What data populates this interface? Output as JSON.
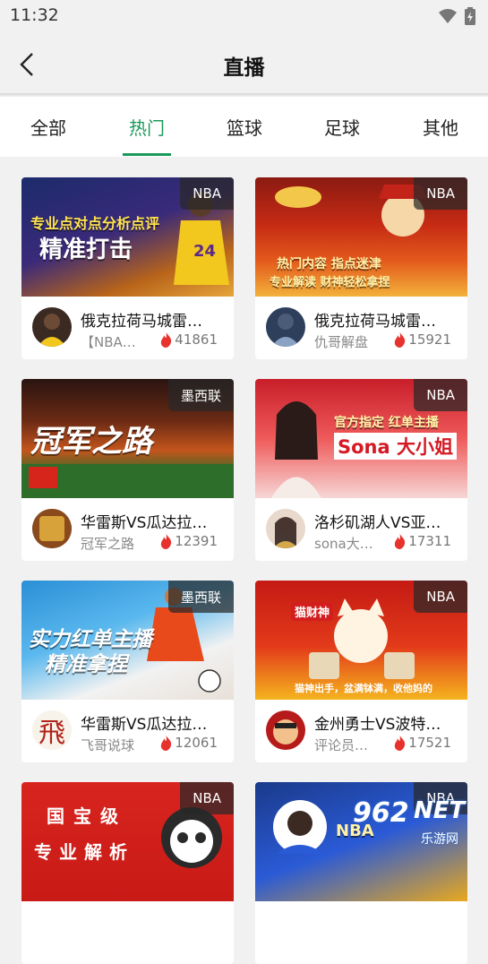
{
  "status_bar": {
    "time": "11:32"
  },
  "header": {
    "title": "直播"
  },
  "tabs": [
    {
      "label": "全部"
    },
    {
      "label": "热门",
      "active": true
    },
    {
      "label": "篮球"
    },
    {
      "label": "足球"
    },
    {
      "label": "其他"
    }
  ],
  "colors": {
    "accent": "#1a9a5a",
    "heat": "#e8322d"
  },
  "cards": [
    {
      "badge": "NBA",
      "thumb_text_1": "专业点对点分析点评",
      "thumb_text_2": "精准打击",
      "title": "俄克拉荷马城雷…",
      "anchor": "【NBA…",
      "heat": "41861",
      "avatar_icon": "player-avatar-icon"
    },
    {
      "badge": "NBA",
      "thumb_text_1": "热门内容 指点迷津",
      "thumb_text_2": "专业解读 财神轻松拿捏",
      "title": "俄克拉荷马城雷…",
      "anchor": "仇哥解盘",
      "heat": "15921",
      "avatar_icon": "player-avatar-icon"
    },
    {
      "badge": "墨西联",
      "thumb_text_1": "冠军之路",
      "thumb_text_2": "",
      "title": "华雷斯VS瓜达拉…",
      "anchor": "冠军之路",
      "heat": "12391",
      "avatar_icon": "player-avatar-icon"
    },
    {
      "badge": "NBA",
      "thumb_text_1": "官方指定 红单主播",
      "thumb_text_2": "Sona 大小姐",
      "title": "洛杉矶湖人VS亚…",
      "anchor": "sona大…",
      "heat": "17311",
      "avatar_icon": "host-avatar-icon"
    },
    {
      "badge": "墨西联",
      "thumb_text_1": "实力红单主播",
      "thumb_text_2": "精准拿捏",
      "title": "华雷斯VS瓜达拉…",
      "anchor": "飞哥说球",
      "heat": "12061",
      "avatar_icon": "calligraphy-avatar-icon",
      "avatar_char": "飛"
    },
    {
      "badge": "NBA",
      "thumb_text_1": "猫财神",
      "thumb_text_2": "猫神出手，盆满钵满，收他妈的",
      "title": "金州勇士VS波特…",
      "anchor": "评论员…",
      "heat": "17521",
      "avatar_icon": "cartoon-avatar-icon"
    },
    {
      "badge": "NBA",
      "thumb_text_1": "国宝级",
      "thumb_text_2": "专业解析",
      "title": "",
      "anchor": "",
      "heat": "",
      "avatar_icon": ""
    },
    {
      "badge": "NBA",
      "thumb_text_1": "NBA",
      "thumb_text_2": "",
      "title": "",
      "anchor": "",
      "heat": "",
      "avatar_icon": ""
    }
  ],
  "watermark": {
    "num": "962",
    "net": "NET",
    "sub": "乐游网"
  }
}
